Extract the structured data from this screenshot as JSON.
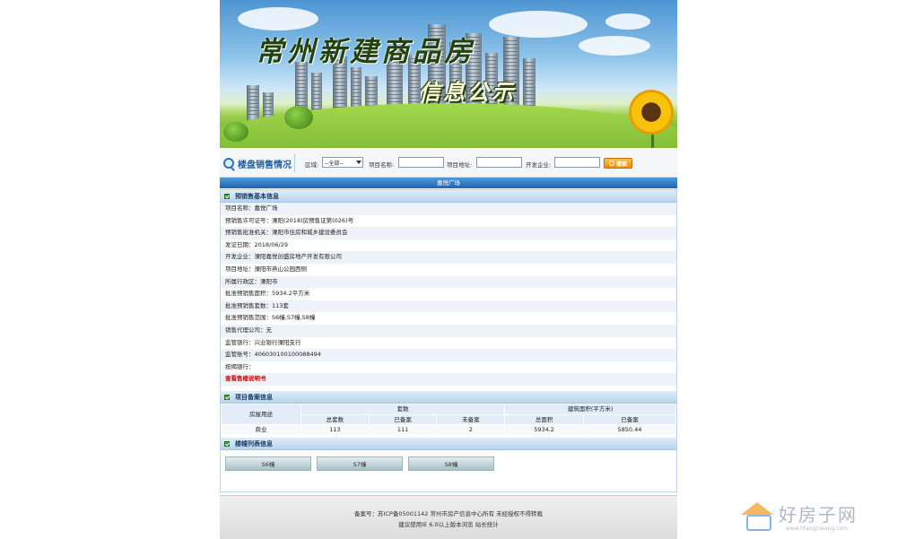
{
  "banner": {
    "title": "常州新建商品房",
    "subtitle": "信息公示"
  },
  "search": {
    "title": "楼盘销售情况",
    "district_label": "区域:",
    "district_value": "--全部--",
    "project_name_label": "项目名称:",
    "project_address_label": "项目地址:",
    "developer_label": "开发企业:",
    "button_label": "搜索"
  },
  "project_bar": "嘉悦广场",
  "basic_info": {
    "title": "预销售基本信息",
    "rows": [
      "项目名称：嘉悦广场",
      "预销售许可证号：溧阳(2018)房预售证第(026)号",
      "预销售批准机关：溧阳市住房和城乡建设委员会",
      "发证日期：2018/06/29",
      "开发企业：溧阳嘉悦创盛房地产开发有限公司",
      "项目地址：溧阳市燕山公园西侧",
      "所属行政区：溧阳市",
      "批准预销售面积：5934.2平方米",
      "批准预销售套数：113套",
      "批准预销售范围：S6幢,S7幢,S8幢",
      "销售代理公司：无",
      "监管银行：兴业银行溧阳支行",
      "监管账号：406030100100088494",
      "按揭银行："
    ],
    "link": "查看售楼说明书"
  },
  "filing": {
    "title": "项目备案信息",
    "col_usage": "房屋用途",
    "group_units": "套数",
    "group_area": "建筑面积(平方米)",
    "sub_total": "总套数",
    "sub_filed": "已备案",
    "sub_unfiled": "未备案",
    "sub_total_area": "总面积",
    "sub_filed_area": "已备案",
    "row": {
      "usage": "商业",
      "total": "113",
      "filed": "111",
      "unfiled": "2",
      "total_area": "5934.2",
      "filed_area": "5850.44"
    }
  },
  "buildings": {
    "title": "楼幢列表信息",
    "items": [
      "S6幢",
      "S7幢",
      "S8幢"
    ]
  },
  "footer": {
    "line1": "备案号：苏ICP备05001142 常州市房产信息中心所有 未经授权不得转载",
    "line2": "建议使用IE 6.0以上版本浏览  站长统计"
  },
  "watermark": {
    "text": "好房子网",
    "url": "www.hfangziwang.com"
  }
}
